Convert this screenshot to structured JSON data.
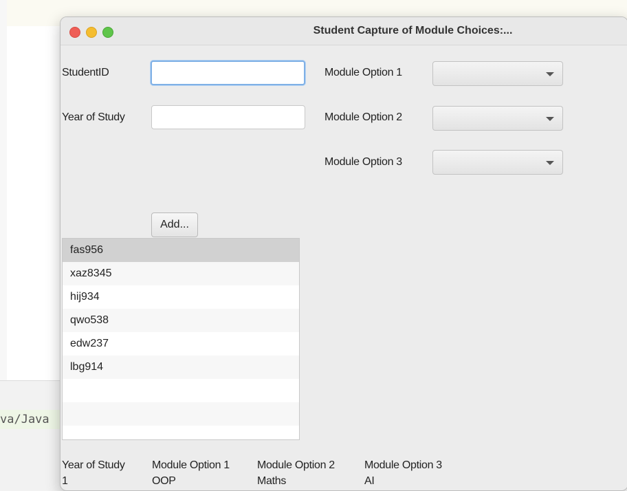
{
  "background": {
    "code_snippet": "va/Java"
  },
  "window": {
    "title": "Student Capture of Module Choices:...",
    "traffic_light_colors": {
      "close": "#ee5e57",
      "minimize": "#f5bd30",
      "zoom": "#5fc54a"
    }
  },
  "form": {
    "student_id_label": "StudentID",
    "student_id_value": "",
    "year_label": "Year of Study",
    "year_value": "",
    "module1_label": "Module Option 1",
    "module2_label": "Module Option 2",
    "module3_label": "Module Option 3",
    "module1_value": "",
    "module2_value": "",
    "module3_value": "",
    "add_button": "Add..."
  },
  "student_list": {
    "items": [
      "fas956",
      "xaz8345",
      "hij934",
      "qwo538",
      "edw237",
      "lbg914"
    ],
    "selected_index": 0
  },
  "summary": {
    "headers": [
      "Year of Study",
      "Module Option 1",
      "Module Option 2",
      "Module Option 3"
    ],
    "values": [
      "1",
      "OOP",
      "Maths",
      "AI"
    ]
  }
}
